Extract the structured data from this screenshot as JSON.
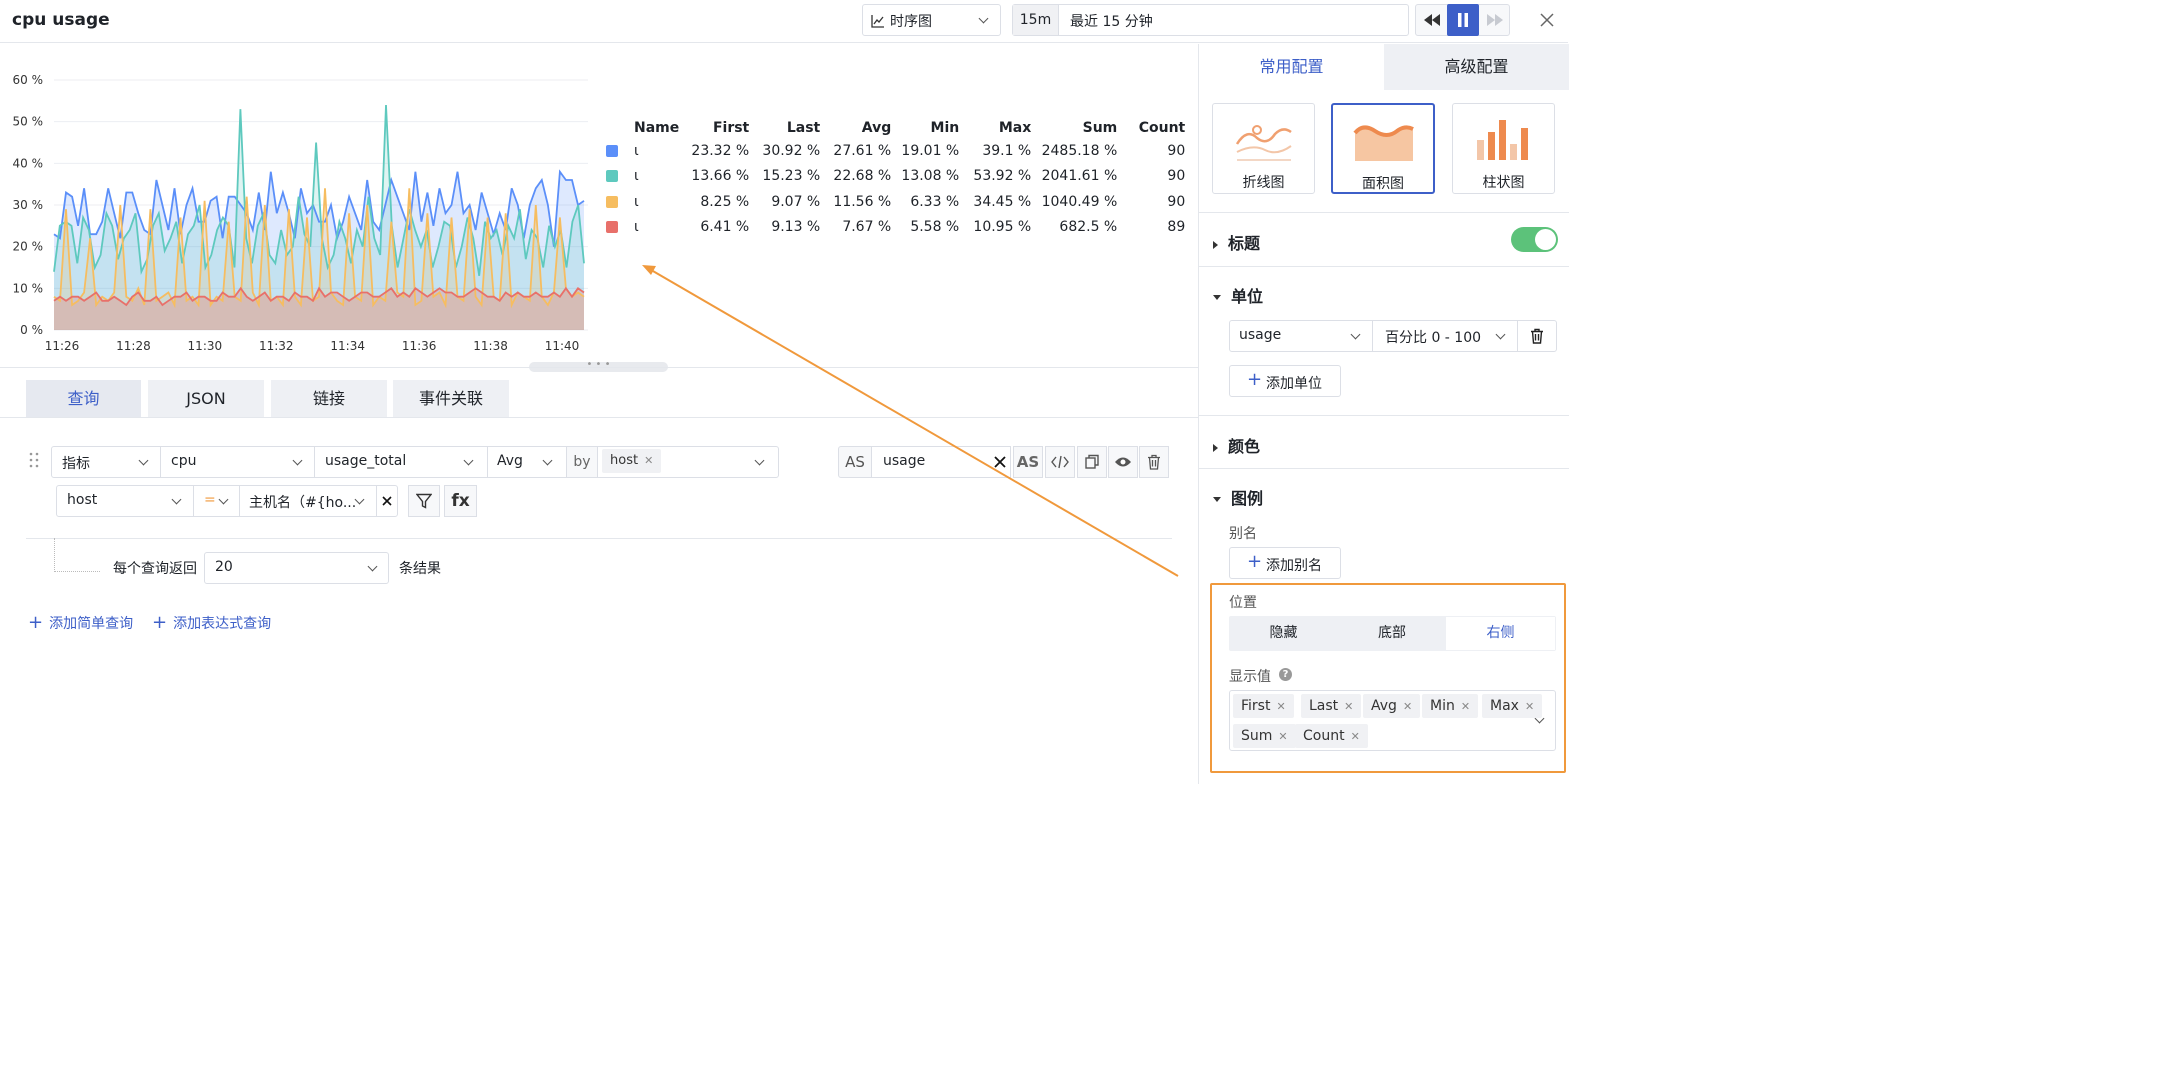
{
  "header": {
    "title": "cpu usage",
    "chart_type_label": "时序图",
    "time_short": "15m",
    "time_range_label": "最近 15 分钟"
  },
  "chart_data": {
    "type": "area",
    "x": [
      "11:26",
      "11:28",
      "11:30",
      "11:32",
      "11:34",
      "11:36",
      "11:38",
      "11:40"
    ],
    "y_ticks": [
      "0 %",
      "10 %",
      "20 %",
      "30 %",
      "40 %",
      "50 %",
      "60 %"
    ],
    "ylim": [
      0,
      60
    ],
    "grid": true,
    "legend_position": "right",
    "series": [
      {
        "color": "#5b8ff9",
        "values": [
          23,
          22,
          33,
          32,
          25,
          34,
          23,
          23,
          26,
          34,
          28,
          22,
          33,
          33,
          28,
          24,
          23,
          36,
          30,
          24,
          34,
          23,
          30,
          34,
          26,
          26,
          31,
          32,
          22,
          32,
          32,
          30,
          28,
          24,
          33,
          24,
          38,
          28,
          33,
          28,
          22,
          34,
          28,
          30,
          26,
          26,
          30,
          22,
          26,
          32,
          28,
          24,
          36,
          26,
          24,
          30,
          36,
          32,
          28,
          24,
          38,
          26,
          33,
          25,
          34,
          28,
          30,
          38,
          28,
          30,
          24,
          33,
          28,
          23,
          28,
          24,
          34,
          30,
          22,
          30,
          34,
          36,
          30,
          20,
          38,
          36,
          36,
          30,
          31
        ]
      },
      {
        "color": "#5ec9be",
        "values": [
          14,
          25,
          26,
          25,
          16,
          27,
          24,
          15,
          18,
          28,
          25,
          17,
          22,
          24,
          28,
          14,
          17,
          25,
          28,
          19,
          22,
          26,
          16,
          23,
          25,
          30,
          15,
          18,
          24,
          27,
          25,
          15,
          53,
          22,
          16,
          25,
          28,
          18,
          16,
          24,
          18,
          20,
          32,
          23,
          20,
          45,
          22,
          15,
          18,
          26,
          22,
          16,
          24,
          20,
          32,
          22,
          18,
          54,
          25,
          15,
          22,
          29,
          24,
          20,
          24,
          15,
          20,
          26,
          25,
          15,
          20,
          27,
          22,
          13,
          26,
          22,
          24,
          18,
          25,
          22,
          29,
          17,
          24,
          22,
          15,
          25,
          20,
          24,
          15,
          26,
          30,
          16
        ]
      },
      {
        "color": "#f6bd60",
        "values": [
          8,
          7,
          29,
          6,
          7,
          9,
          22,
          6,
          8,
          7,
          9,
          30,
          8,
          7,
          10,
          6,
          29,
          7,
          8,
          9,
          6,
          27,
          7,
          8,
          6,
          31,
          6,
          8,
          7,
          26,
          8,
          7,
          32,
          9,
          6,
          30,
          7,
          8,
          6,
          29,
          8,
          6,
          27,
          7,
          8,
          34,
          9,
          7,
          6,
          28,
          8,
          7,
          30,
          6,
          8,
          7,
          26,
          9,
          8,
          34,
          6,
          7,
          28,
          8,
          9,
          6,
          27,
          8,
          7,
          29,
          8,
          6,
          27,
          8,
          7,
          28,
          6,
          9,
          8,
          7,
          30,
          8,
          6,
          9,
          27,
          10,
          8,
          9,
          8
        ]
      },
      {
        "color": "#e8706a",
        "values": [
          7,
          8,
          7,
          8,
          8,
          7,
          8,
          9,
          7,
          7,
          8,
          7,
          6,
          8,
          9,
          7,
          7,
          8,
          6,
          7,
          8,
          8,
          9,
          7,
          8,
          8,
          7,
          7,
          9,
          8,
          8,
          10,
          8,
          7,
          8,
          9,
          7,
          8,
          8,
          7,
          9,
          8,
          8,
          7,
          10,
          8,
          9,
          9,
          8,
          7,
          8,
          9,
          9,
          8,
          8,
          9,
          10,
          8,
          9,
          8,
          10,
          9,
          8,
          9,
          10,
          9,
          9,
          8,
          8,
          9,
          10,
          9,
          8,
          8,
          7,
          9,
          8,
          9,
          8,
          8,
          9,
          8,
          8,
          9,
          8,
          10,
          8,
          10,
          9
        ]
      }
    ]
  },
  "legend": {
    "headers": [
      "Name",
      "First",
      "Last",
      "Avg",
      "Min",
      "Max",
      "Sum",
      "Count"
    ],
    "rows": [
      {
        "color": "#5b8ff9",
        "name": "ι",
        "first": "23.32 %",
        "last": "30.92 %",
        "avg": "27.61 %",
        "min": "19.01 %",
        "max": "39.1 %",
        "sum": "2485.18 %",
        "count": "90"
      },
      {
        "color": "#5ec9be",
        "name": "ι",
        "first": "13.66 %",
        "last": "15.23 %",
        "avg": "22.68 %",
        "min": "13.08 %",
        "max": "53.92 %",
        "sum": "2041.61 %",
        "count": "90"
      },
      {
        "color": "#f6bd60",
        "name": "ι",
        "first": "8.25 %",
        "last": "9.07 %",
        "avg": "11.56 %",
        "min": "6.33 %",
        "max": "34.45 %",
        "sum": "1040.49 %",
        "count": "90"
      },
      {
        "color": "#e8706a",
        "name": "ι",
        "first": "6.41 %",
        "last": "9.13 %",
        "avg": "7.67 %",
        "min": "5.58 %",
        "max": "10.95 %",
        "sum": "682.5 %",
        "count": "89"
      }
    ]
  },
  "query_tabs": [
    "查询",
    "JSON",
    "链接",
    "事件关联"
  ],
  "query": {
    "source": "指标",
    "measurement": "cpu",
    "field": "usage_total",
    "agg": "Avg",
    "by_label": "by",
    "by_tag": "host",
    "as_label": "AS",
    "alias": "usage",
    "as_btn": "AS",
    "filter_key": "host",
    "filter_op": "=",
    "filter_value": "主机名（#{ho...",
    "fx_label": "fx",
    "limit_prefix": "每个查询返回",
    "limit_value": "20",
    "limit_suffix": "条结果",
    "add_simple": "添加简单查询",
    "add_expr": "添加表达式查询"
  },
  "panel": {
    "tab_common": "常用配置",
    "tab_advanced": "高级配置",
    "chart_types": [
      {
        "label": "折线图",
        "icon": "line-chart-icon"
      },
      {
        "label": "面积图",
        "icon": "area-chart-icon"
      },
      {
        "label": "柱状图",
        "icon": "bar-chart-icon"
      }
    ],
    "title_section": "标题",
    "unit_section": "单位",
    "unit_field": "usage",
    "unit_value": "百分比 0 - 100",
    "add_unit": "添加单位",
    "color_section": "颜色",
    "legend_section": "图例",
    "alias_label": "别名",
    "add_alias": "添加别名",
    "position_label": "位置",
    "positions": [
      "隐藏",
      "底部",
      "右侧"
    ],
    "display_label": "显示值",
    "display_values": [
      "First",
      "Last",
      "Avg",
      "Min",
      "Max",
      "Sum",
      "Count"
    ]
  },
  "colors": {
    "accent": "#3d5fc8",
    "highlight": "#f0993c",
    "toggle": "#5cc27a"
  }
}
